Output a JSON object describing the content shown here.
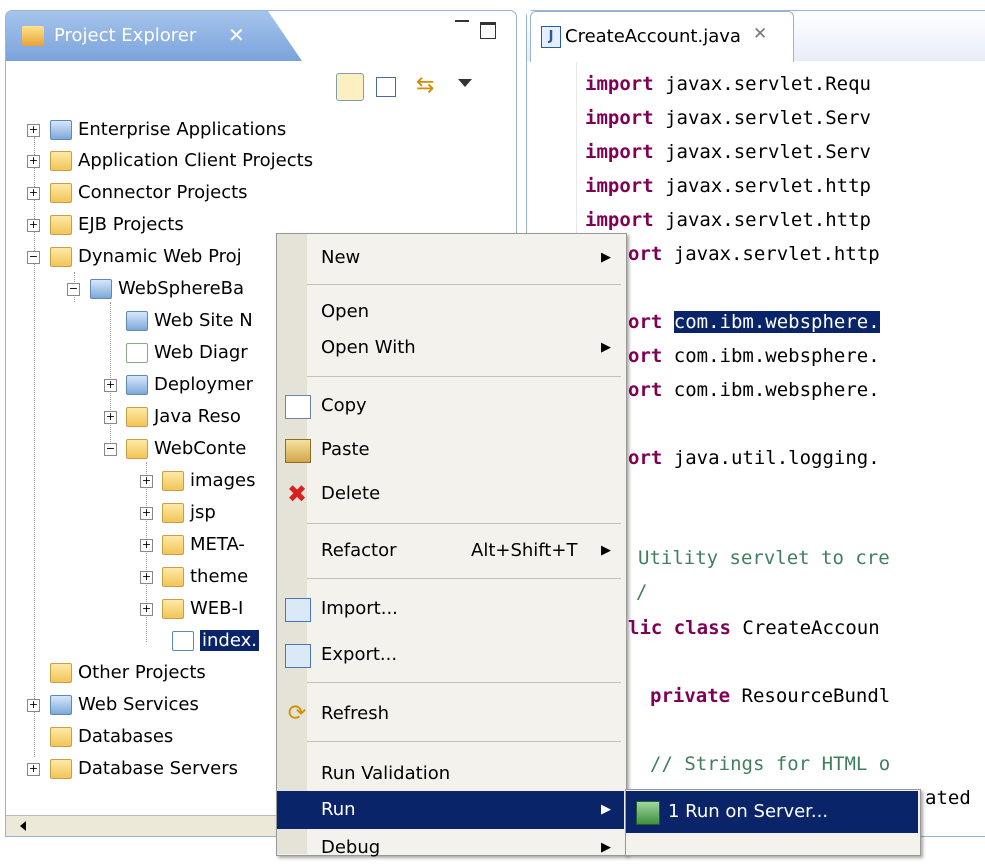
{
  "project_explorer": {
    "title": "Project Explorer",
    "close_glyph": "✕",
    "tree": [
      {
        "label": "Enterprise Applications"
      },
      {
        "label": "Application Client Projects"
      },
      {
        "label": "Connector Projects"
      },
      {
        "label": "EJB Projects"
      },
      {
        "label": "Dynamic Web Proj"
      },
      {
        "label": "WebSphereBa"
      },
      {
        "label": "Web Site N"
      },
      {
        "label": "Web Diagr"
      },
      {
        "label": "Deploymer"
      },
      {
        "label": "Java Reso"
      },
      {
        "label": "WebConte"
      },
      {
        "label": "images"
      },
      {
        "label": "jsp"
      },
      {
        "label": "META-"
      },
      {
        "label": "theme"
      },
      {
        "label": "WEB-I"
      },
      {
        "label": "index."
      },
      {
        "label": "Other Projects"
      },
      {
        "label": "Web Services"
      },
      {
        "label": "Databases"
      },
      {
        "label": "Database Servers"
      }
    ]
  },
  "editor": {
    "tab_label": "CreateAccount.java",
    "lines": [
      {
        "kw": "import",
        "rest": " javax.servlet.Requ"
      },
      {
        "kw": "import",
        "rest": " javax.servlet.Serv"
      },
      {
        "kw": "import",
        "rest": " javax.servlet.Serv"
      },
      {
        "kw": "import",
        "rest": " javax.servlet.http"
      },
      {
        "kw": "import",
        "rest": " javax.servlet.http"
      },
      {
        "kw": "ort",
        "rest": " javax.servlet.http"
      },
      {
        "kw": "ort",
        "rest": " ",
        "hl": "com.ibm.websphere."
      },
      {
        "kw": "ort",
        "rest": " com.ibm.websphere."
      },
      {
        "kw": "ort",
        "rest": " com.ibm.websphere."
      },
      {
        "kw": "ort",
        "rest": " java.util.logging."
      },
      {
        "cm": "Utility servlet to cre"
      },
      {
        "cm": "/"
      },
      {
        "kw": "lic class",
        "rest": " CreateAccoun"
      },
      {
        "kw": "private",
        "rest": " ResourceBundl"
      },
      {
        "cm": "// Strings for HTML o"
      },
      {
        "rest": "ated"
      }
    ]
  },
  "context_menu": {
    "items": [
      {
        "label": "New",
        "submenu": true
      },
      {
        "label": "Open"
      },
      {
        "label": "Open With",
        "submenu": true
      },
      {
        "label": "Copy"
      },
      {
        "label": "Paste"
      },
      {
        "label": "Delete"
      },
      {
        "label": "Refactor",
        "accel": "Alt+Shift+T",
        "submenu": true
      },
      {
        "label": "Import..."
      },
      {
        "label": "Export..."
      },
      {
        "label": "Refresh"
      },
      {
        "label": "Run Validation"
      },
      {
        "label": "Run",
        "submenu": true
      },
      {
        "label": "Debug",
        "submenu": true
      }
    ],
    "submenu_run": {
      "label": "1 Run on Server..."
    }
  },
  "colors": {
    "selection": "#0a246a",
    "keyword": "#7f0055",
    "comment": "#3f7f5f",
    "tab_active": "#7ba3db"
  }
}
